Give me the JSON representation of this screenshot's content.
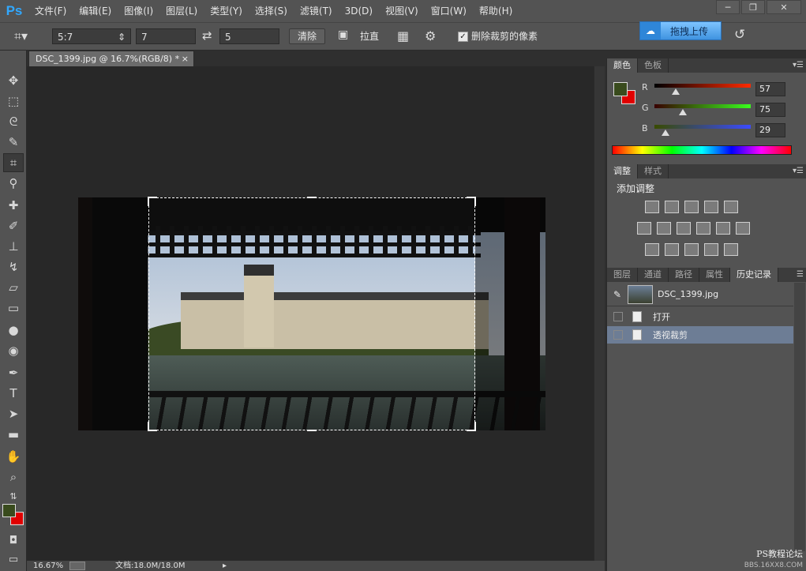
{
  "app": {
    "logo": "Ps"
  },
  "menu": [
    "文件(F)",
    "编辑(E)",
    "图像(I)",
    "图层(L)",
    "类型(Y)",
    "选择(S)",
    "滤镜(T)",
    "3D(D)",
    "视图(V)",
    "窗口(W)",
    "帮助(H)"
  ],
  "window_controls": [
    "─",
    "❐",
    "✕"
  ],
  "options": {
    "ratio": "5:7",
    "ratio_arrow": "⇕",
    "width_value": "7",
    "swap_icon": "⇄",
    "height_value": "5",
    "clear_label": "清除",
    "straighten_label": "拉直",
    "delete_cropped_label": "删除裁剪的像素",
    "delete_cropped_checked": true,
    "upload_label": "拖拽上传"
  },
  "document": {
    "tab_title": "DSC_1399.jpg @ 16.7%(RGB/8) *",
    "zoom": "16.67%",
    "doc_size": "文档:18.0M/18.0M"
  },
  "colors": {
    "foreground": "#394b1d",
    "background": "#e00000",
    "accent": "#31a8ff"
  },
  "color_panel": {
    "tabs": [
      "颜色",
      "色板"
    ],
    "r_label": "R",
    "g_label": "G",
    "b_label": "B",
    "r_value": "57",
    "g_value": "75",
    "b_value": "29"
  },
  "adjust_panel": {
    "tabs": [
      "调整",
      "样式"
    ],
    "title": "添加调整"
  },
  "history_panel": {
    "tabs": [
      "图层",
      "通道",
      "路径",
      "属性",
      "历史记录"
    ],
    "snapshot": "DSC_1399.jpg",
    "items": [
      {
        "label": "打开",
        "selected": false
      },
      {
        "label": "透视裁剪",
        "selected": true
      }
    ]
  },
  "watermark": {
    "line1": "PS教程论坛",
    "line2": "BBS.16XX8.COM"
  }
}
